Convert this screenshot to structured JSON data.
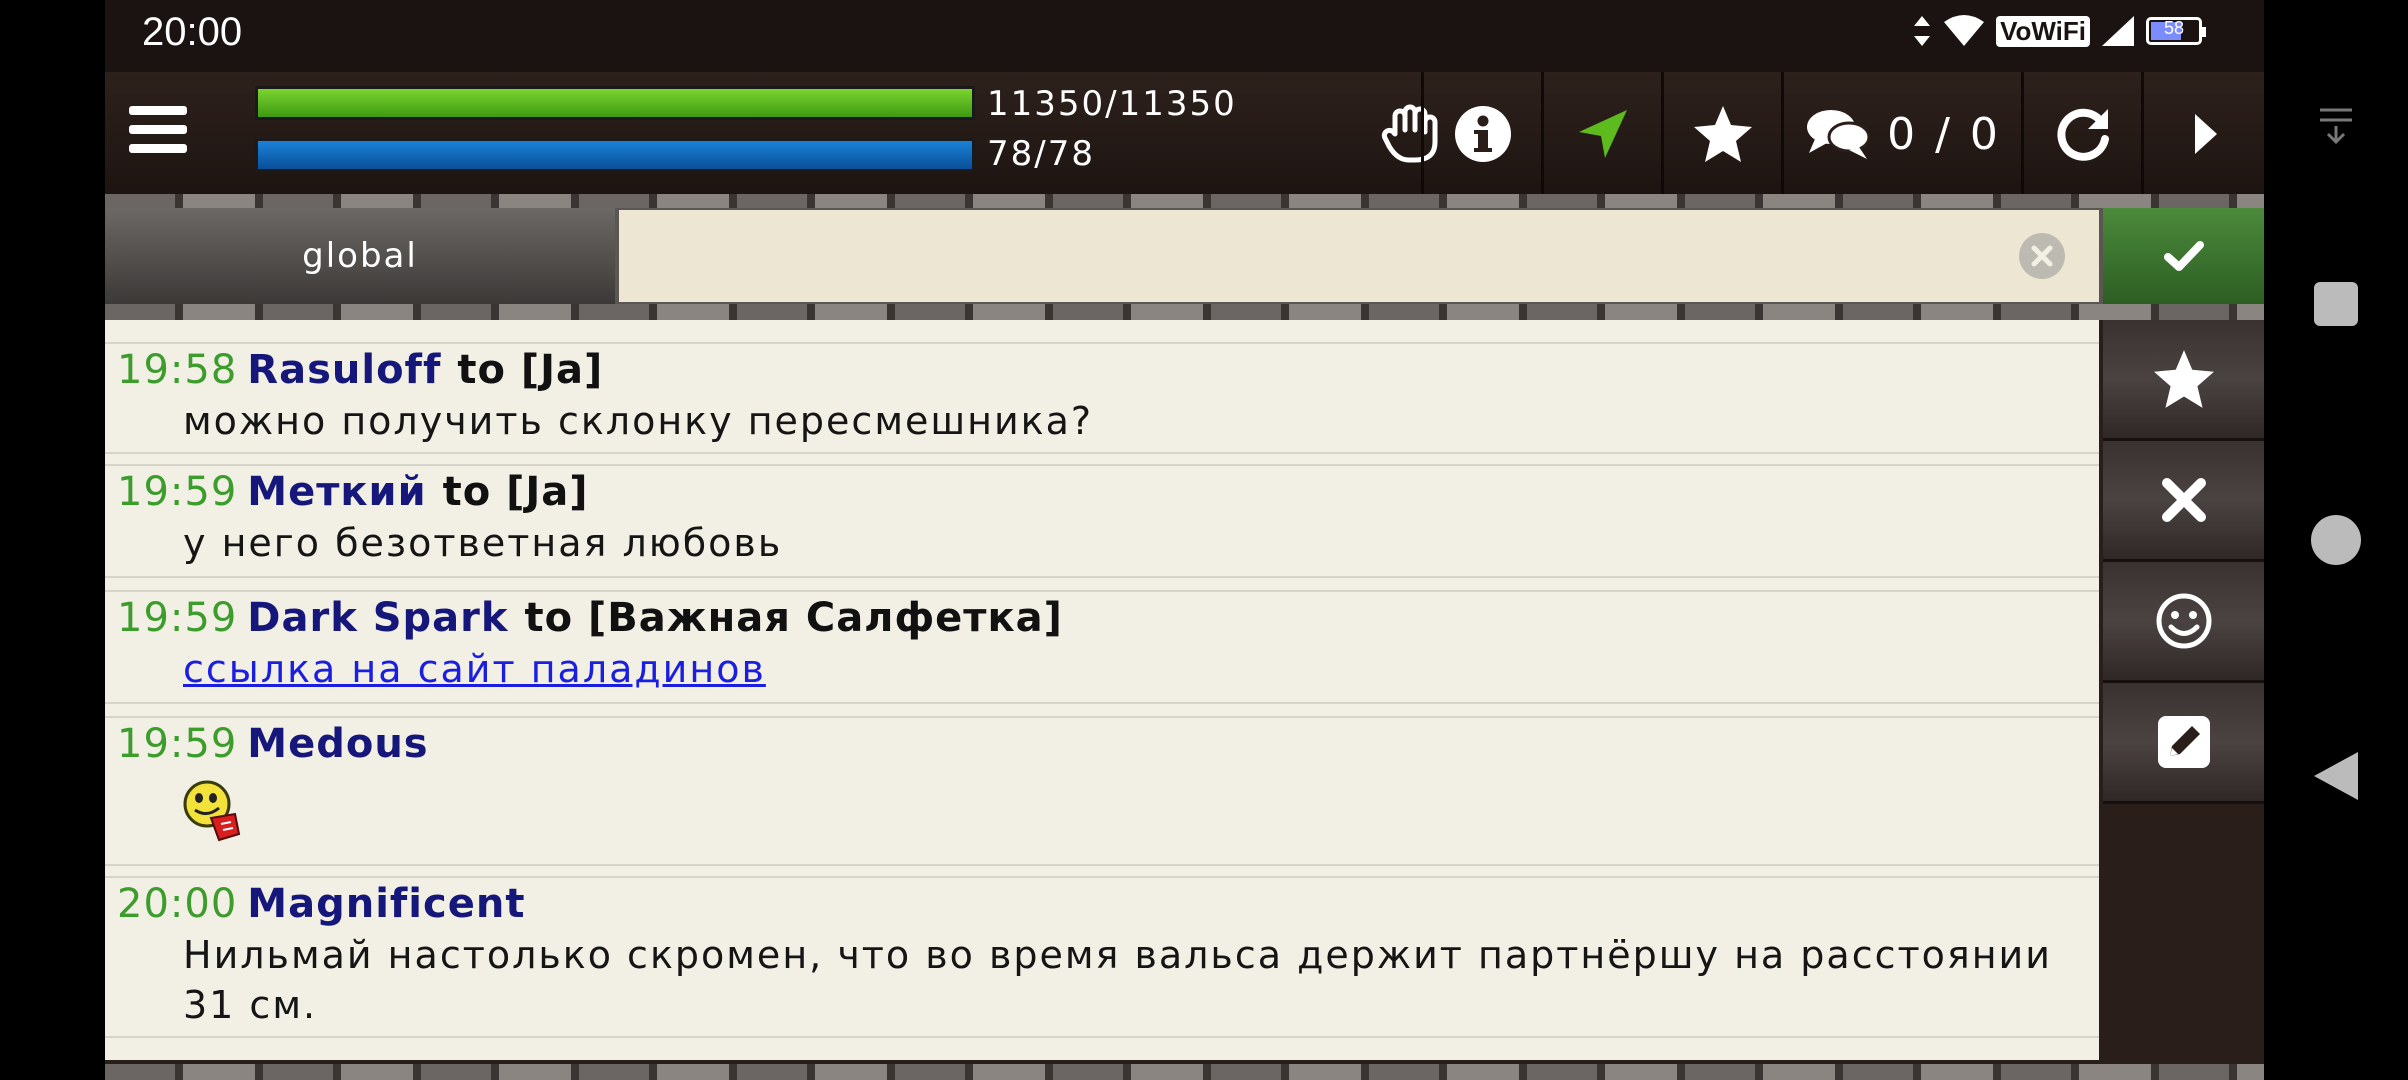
{
  "status_bar": {
    "time": "20:00",
    "network_label": "VoWiFi",
    "battery_level": "58",
    "icons": [
      "data-arrows-icon",
      "wifi-icon",
      "vowifi-icon",
      "signal-icon",
      "battery-icon"
    ]
  },
  "toolbar": {
    "hp_text": "11350/11350",
    "hp_fraction": 1.0,
    "mp_text": "78/78",
    "mp_fraction": 1.0,
    "message_count": "0 / 0",
    "icons": [
      "menu-icon",
      "hand-icon",
      "info-icon",
      "navigation-arrow-icon",
      "star-icon",
      "chat-bubbles-icon",
      "refresh-icon",
      "play-arrow-icon"
    ],
    "nav_accent_color": "#5dbb1e"
  },
  "channel": {
    "tab_label": "global",
    "input_value": "",
    "input_placeholder": ""
  },
  "messages": [
    {
      "time": "19:58",
      "nick": "Rasuloff",
      "to": "to [Ja]",
      "text": "можно получить склонку пересмешника?",
      "type": "text"
    },
    {
      "time": "19:59",
      "nick": "Меткий",
      "to": "to [Ja]",
      "text": "у него безответная любовь",
      "type": "text"
    },
    {
      "time": "19:59",
      "nick": "Dark Spark",
      "to": "to [Важная Салфетка]",
      "text": "ссылка на сайт паладинов",
      "type": "link"
    },
    {
      "time": "19:59",
      "nick": "Medous",
      "to": "",
      "text": "",
      "type": "smiley"
    },
    {
      "time": "20:00",
      "nick": "Magnificent",
      "to": "",
      "text": "Нильмай настолько скромен, что во время вальса держит партнёршу на расстоянии 31 см.",
      "type": "text"
    }
  ],
  "side_panel": {
    "icons": [
      "star-icon",
      "close-icon",
      "smiley-icon",
      "edit-icon"
    ]
  },
  "colors": {
    "time": "#3c9c2c",
    "nick": "#16177a",
    "link": "#1a1ee0",
    "send_button": "#3d7a2f",
    "chat_background": "#f2efe4"
  }
}
